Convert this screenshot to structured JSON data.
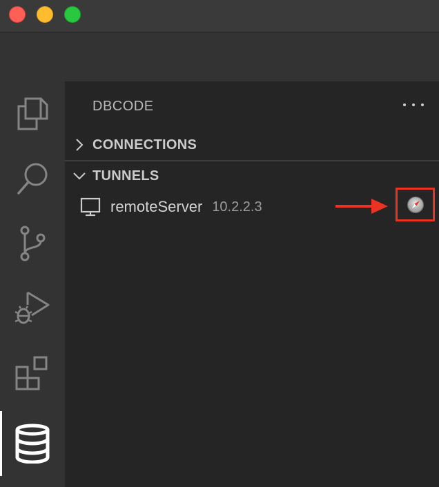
{
  "window": {
    "traffic_lights": [
      "close",
      "minimize",
      "zoom"
    ],
    "colors": {
      "close": "#fe5f57",
      "minimize": "#febc2e",
      "zoom": "#28c840"
    }
  },
  "activity_bar": {
    "items": [
      {
        "id": "explorer",
        "icon": "files-icon"
      },
      {
        "id": "search",
        "icon": "search-icon"
      },
      {
        "id": "source-control",
        "icon": "source-control-icon"
      },
      {
        "id": "run-debug",
        "icon": "run-debug-icon"
      },
      {
        "id": "extensions",
        "icon": "extensions-icon"
      },
      {
        "id": "dbcode",
        "icon": "database-icon",
        "active": true
      }
    ]
  },
  "sidebar": {
    "title": "DBCODE",
    "more_actions_icon": "ellipsis-icon",
    "sections": [
      {
        "label": "CONNECTIONS",
        "expanded": false
      },
      {
        "label": "TUNNELS",
        "expanded": true
      }
    ],
    "tunnels": [
      {
        "name": "remoteServer",
        "host": "10.2.2.3",
        "icon": "monitor-icon",
        "action_icon": "compass-icon"
      }
    ]
  },
  "annotation": {
    "arrow_color": "#ea3323",
    "highlight_color": "#ea3323"
  }
}
